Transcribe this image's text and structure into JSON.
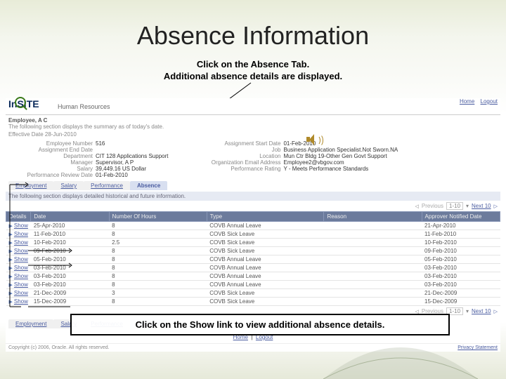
{
  "slide": {
    "title": "Absence Information",
    "subtitle_line1": "Click on the Absence Tab.",
    "subtitle_line2": "Additional absence details are displayed.",
    "bottom_callout": "Click on the Show link to view additional absence details."
  },
  "app": {
    "logo_text": "InSITE",
    "module": "Human Resources",
    "top_links": {
      "home": "Home",
      "logout": "Logout"
    },
    "employee_name": "Employee, A C",
    "summary_note": "The following section displays the summary as of today's date.",
    "effective_date_label": "Effective Date 28-Jun-2010",
    "left_fields": {
      "emp_no_label": "Employee Number",
      "emp_no": "516",
      "end_date_label": "Assignment End Date",
      "end_date": "",
      "dept_label": "Department",
      "dept": "CIT 128 Applications Support",
      "mgr_label": "Manager",
      "mgr": "Supervisor, A P",
      "salary_label": "Salary",
      "salary": "39,449.16 US Dollar",
      "perf_label": "Performance Review Date",
      "perf": "01-Feb-2010"
    },
    "right_fields": {
      "start_label": "Assignment Start Date",
      "start": "01-Feb-2010",
      "job_label": "Job",
      "job": "Business Application Specialist.Not Sworn.NA",
      "loc_label": "Location",
      "loc": "Mun Ctr Bldg 19-Other Gen Govt Support",
      "email_label": "Organization Email Address",
      "email": "Employee2@vbgov.com",
      "rating_label": "Performance Rating",
      "rating": "Y - Meets Performance Standards"
    },
    "tabs": {
      "employment": "Employment",
      "salary": "Salary",
      "performance": "Performance",
      "absence": "Absence"
    },
    "section_note": "The following section displays detailed historical and future information.",
    "pager": {
      "prev": "Previous",
      "range": "1-10",
      "next": "Next 10"
    },
    "columns": {
      "details": "Details",
      "date": "Date",
      "hours": "Number Of Hours",
      "type": "Type",
      "reason": "Reason",
      "approver": "Approver Notified Date"
    },
    "show_label": "Show",
    "rows": [
      {
        "date": "25-Apr-2010",
        "hours": "8",
        "type": "COVB Annual Leave",
        "reason": "",
        "appr": "21-Apr-2010"
      },
      {
        "date": "11-Feb-2010",
        "hours": "8",
        "type": "COVB Sick Leave",
        "reason": "",
        "appr": "11-Feb-2010"
      },
      {
        "date": "10-Feb-2010",
        "hours": "2.5",
        "type": "COVB Sick Leave",
        "reason": "",
        "appr": "10-Feb-2010"
      },
      {
        "date": "09-Feb-2010",
        "hours": "8",
        "type": "COVB Sick Leave",
        "reason": "",
        "appr": "09-Feb-2010"
      },
      {
        "date": "05-Feb-2010",
        "hours": "8",
        "type": "COVB Annual Leave",
        "reason": "",
        "appr": "05-Feb-2010"
      },
      {
        "date": "03-Feb-2010",
        "hours": "8",
        "type": "COVB Annual Leave",
        "reason": "",
        "appr": "03-Feb-2010"
      },
      {
        "date": "03-Feb-2010",
        "hours": "8",
        "type": "COVB Annual Leave",
        "reason": "",
        "appr": "03-Feb-2010"
      },
      {
        "date": "03-Feb-2010",
        "hours": "8",
        "type": "COVB Annual Leave",
        "reason": "",
        "appr": "03-Feb-2010"
      },
      {
        "date": "21-Dec-2009",
        "hours": "3",
        "type": "COVB Sick Leave",
        "reason": "",
        "appr": "21-Dec-2009"
      },
      {
        "date": "15-Dec-2009",
        "hours": "8",
        "type": "COVB Sick Leave",
        "reason": "",
        "appr": "15-Dec-2009"
      }
    ],
    "footer_center": {
      "home": "Home",
      "logout": "Logout"
    },
    "copyright": "Copyright (c) 2006, Oracle. All rights reserved.",
    "privacy": "Privacy Statement"
  }
}
